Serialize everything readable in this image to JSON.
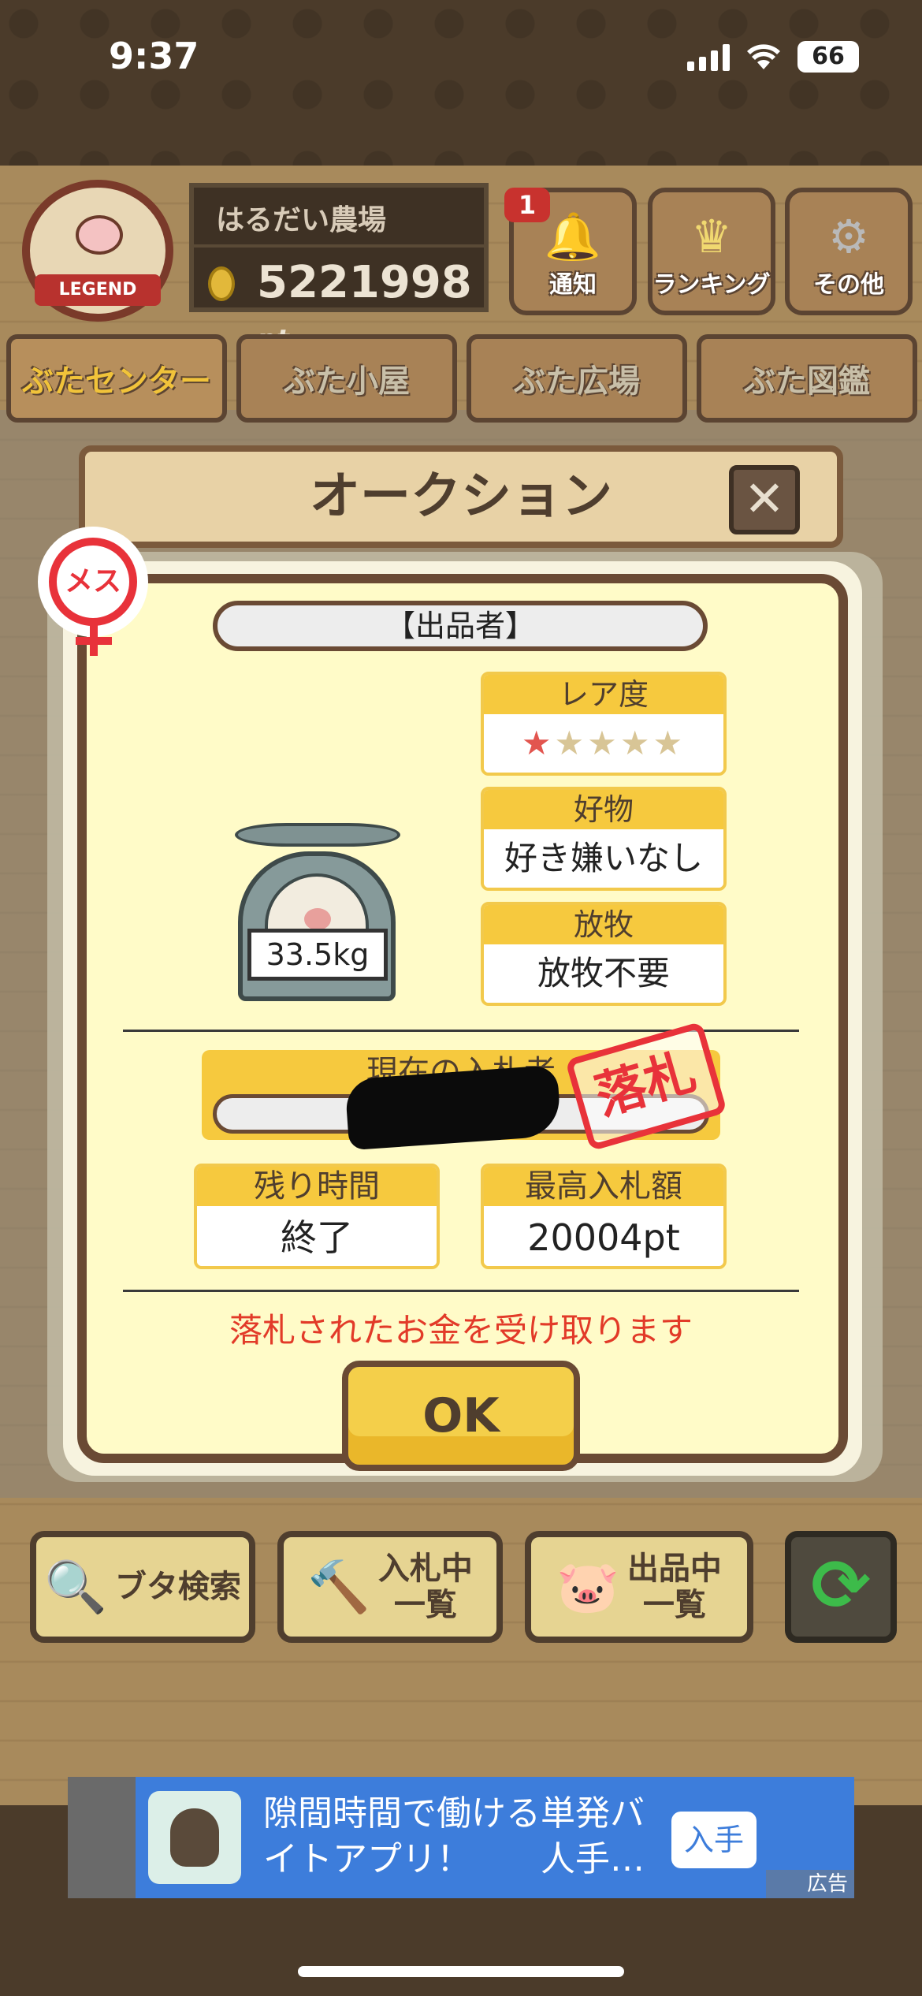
{
  "status_bar": {
    "time": "9:37",
    "battery": "66"
  },
  "header": {
    "badge_text": "LEGEND",
    "farm_name": "はるだい農場",
    "points": "5221998",
    "points_unit": "pt",
    "buttons": [
      {
        "label": "通知",
        "icon": "bell-icon",
        "badge": "1"
      },
      {
        "label": "ランキング",
        "icon": "crown-icon"
      },
      {
        "label": "その他",
        "icon": "gear-icon"
      }
    ]
  },
  "tabs": [
    {
      "label": "ぶたセンター",
      "active": true
    },
    {
      "label": "ぶた小屋",
      "active": false
    },
    {
      "label": "ぶた広場",
      "active": false
    },
    {
      "label": "ぶた図鑑",
      "active": false
    }
  ],
  "modal": {
    "title": "オークション",
    "close_label": "✕",
    "gender_badge": "メス",
    "seller_label": "【出品者】",
    "weight": "33.5kg",
    "rarity": {
      "label": "レア度",
      "filled": 1,
      "total": 5
    },
    "favorite": {
      "label": "好物",
      "value": "好き嫌いなし"
    },
    "grazing": {
      "label": "放牧",
      "value": "放牧不要"
    },
    "current_bidder_label": "現在の入札者",
    "sold_stamp": "落札",
    "remaining": {
      "label": "残り時間",
      "value": "終了"
    },
    "highest_bid": {
      "label": "最高入札額",
      "value": "20004pt"
    },
    "message": "落札されたお金を受け取ります",
    "ok_label": "OK"
  },
  "bottom_buttons": [
    {
      "label": "ブタ検索",
      "icon": "magnifier-icon"
    },
    {
      "label": "入札中\n一覧",
      "icon": "gavel-icon"
    },
    {
      "label": "出品中\n一覧",
      "icon": "pig-icon"
    }
  ],
  "ad": {
    "text": "隙間時間で働ける単発バイトアプリ！　　人手…",
    "cta": "入手",
    "label": "広告"
  },
  "colors": {
    "accent_yellow": "#f6c93e",
    "modal_bg": "#fffbc8",
    "message_red": "#e23a28",
    "stamp_red": "#e8323a",
    "ad_blue": "#3d7ddb"
  }
}
